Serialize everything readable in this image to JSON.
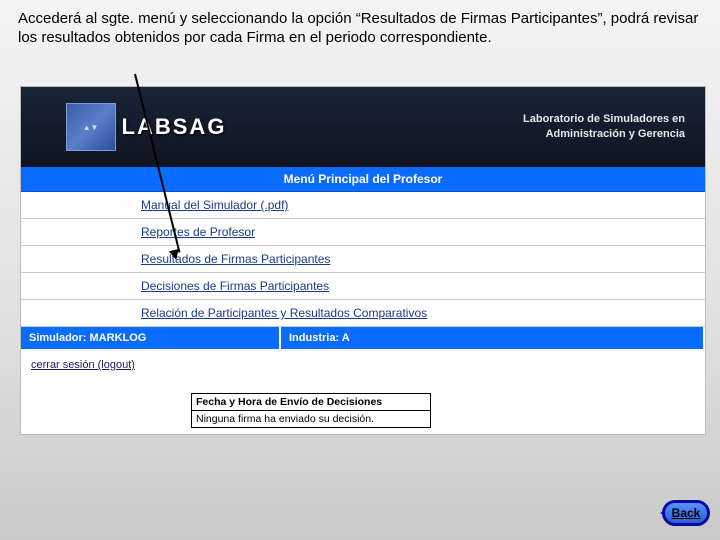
{
  "intro_text": "Accederá al sgte. menú y seleccionando la opción “Resultados de Firmas Participantes”, podrá revisar los resultados obtenidos por cada Firma en el periodo correspondiente.",
  "banner": {
    "logo_text": "LABSAG",
    "tagline1": "Laboratorio de Simuladores en",
    "tagline2": "Administración y Gerencia"
  },
  "menu": {
    "header": "Menú Principal del Profesor",
    "items": [
      "Manual del Simulador (.pdf)",
      "Reportes de Profesor",
      "Resultados de Firmas Participantes",
      "Decisiones de Firmas Participantes",
      "Relación de Participantes y Resultados Comparativos"
    ]
  },
  "simrow": {
    "sim_label": "Simulador:",
    "sim_value": "MARKLOG",
    "ind_label": "Industria:",
    "ind_value": "A"
  },
  "logout_text": "cerrar sesión (logout)",
  "notice": {
    "header": "Fecha y Hora de Envío de Decisiones",
    "body": "Ninguna firma ha enviado su decisión."
  },
  "back_label": "Back"
}
